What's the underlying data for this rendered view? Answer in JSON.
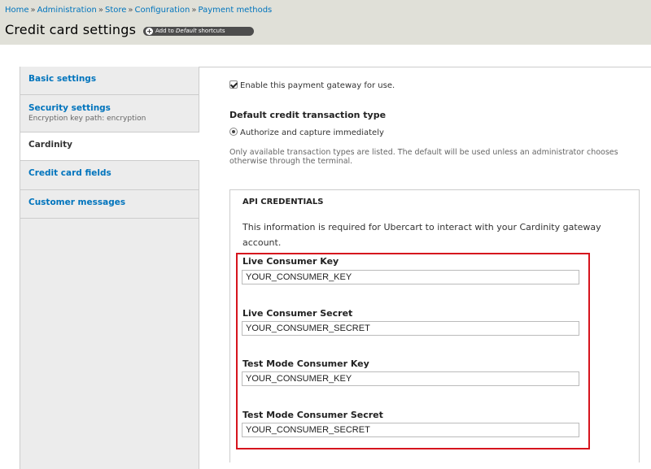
{
  "breadcrumb": {
    "items": [
      "Home",
      "Administration",
      "Store",
      "Configuration",
      "Payment methods"
    ],
    "separator": "»"
  },
  "page": {
    "title": "Credit card settings",
    "shortcut_prefix": "Add to ",
    "shortcut_italic": "Default",
    "shortcut_suffix": " shortcuts"
  },
  "tabs": [
    {
      "label": "Basic settings",
      "description": ""
    },
    {
      "label": "Security settings",
      "description": "Encryption key path: encryption"
    },
    {
      "label": "Cardinity",
      "description": ""
    },
    {
      "label": "Credit card fields",
      "description": ""
    },
    {
      "label": "Customer messages",
      "description": ""
    }
  ],
  "form": {
    "enable_label": "Enable this payment gateway for use.",
    "enable_checked": true,
    "transaction_type_label": "Default credit transaction type",
    "transaction_option": "Authorize and capture immediately",
    "transaction_help": "Only available transaction types are listed. The default will be used unless an administrator chooses otherwise through the terminal."
  },
  "api_credentials": {
    "legend": "API CREDENTIALS",
    "description": "This information is required for Ubercart to interact with your Cardinity gateway account.",
    "fields": [
      {
        "label": "Live Consumer Key",
        "value": "YOUR_CONSUMER_KEY"
      },
      {
        "label": "Live Consumer Secret",
        "value": "YOUR_CONSUMER_SECRET"
      },
      {
        "label": "Test Mode Consumer Key",
        "value": "YOUR_CONSUMER_KEY"
      },
      {
        "label": "Test Mode Consumer Secret",
        "value": "YOUR_CONSUMER_SECRET"
      }
    ]
  },
  "colors": {
    "link": "#0074bd",
    "highlight_border": "#d6141d",
    "header_bg": "#e0e0d8"
  }
}
